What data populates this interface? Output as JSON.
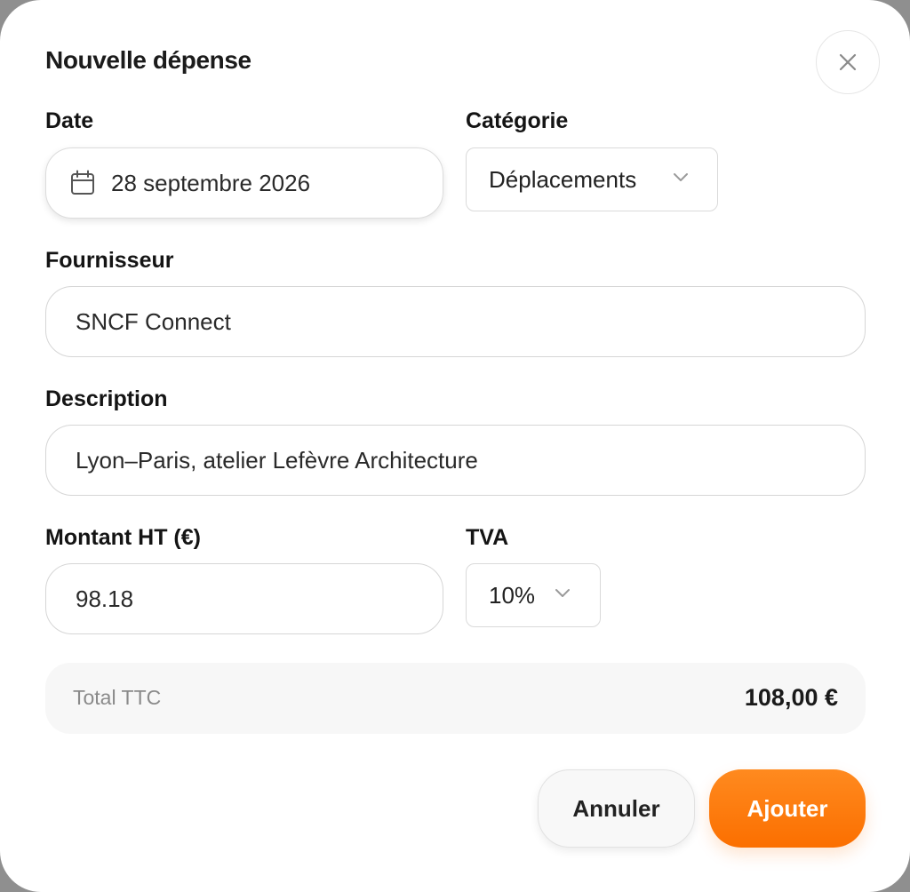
{
  "dialog": {
    "title": "Nouvelle dépense",
    "close_icon": "close-icon"
  },
  "form": {
    "date": {
      "label": "Date",
      "value": "28 septembre 2026",
      "icon": "calendar-icon"
    },
    "category": {
      "label": "Catégorie",
      "value": "Déplacements",
      "icon": "chevron-down-icon"
    },
    "supplier": {
      "label": "Fournisseur",
      "value": "SNCF Connect"
    },
    "description": {
      "label": "Description",
      "value": "Lyon–Paris, atelier Lefèvre Architecture"
    },
    "amount_ht": {
      "label": "Montant HT (€)",
      "value": "98.18"
    },
    "vat": {
      "label": "TVA",
      "value": "10%",
      "icon": "chevron-down-icon"
    }
  },
  "total": {
    "label": "Total TTC",
    "value": "108,00 €"
  },
  "actions": {
    "cancel_label": "Annuler",
    "add_label": "Ajouter"
  },
  "colors": {
    "accent": "#fb6f00",
    "background": "#ffffff",
    "muted": "#8a8a8a"
  }
}
